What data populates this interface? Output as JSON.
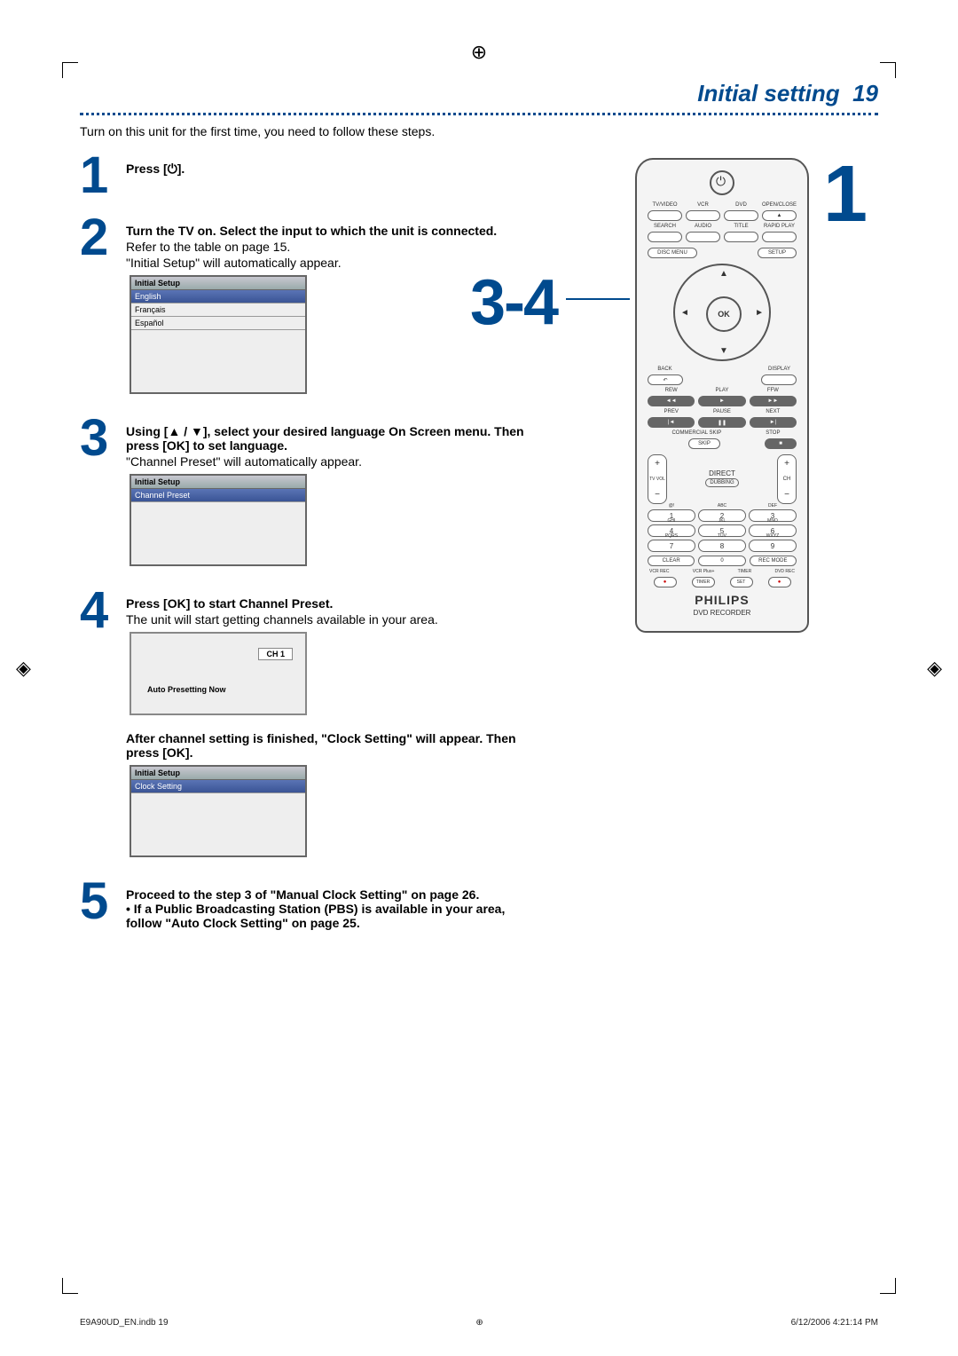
{
  "header": {
    "title": "Initial setting",
    "page": "19"
  },
  "intro": "Turn on this unit for the first time, you need to follow these steps.",
  "steps": {
    "s1": {
      "n": "1",
      "text": "Press [⏻]."
    },
    "s2": {
      "n": "2",
      "bold": "Turn the TV on. Select the input to which the unit is connected.",
      "line1": "Refer to the table on page 15.",
      "line2": "\"Initial Setup\" will automatically appear."
    },
    "s3": {
      "n": "3",
      "bold": "Using [▲ / ▼], select your desired language On Screen menu. Then press [OK] to set language.",
      "line1": "\"Channel Preset\" will automatically appear."
    },
    "s4": {
      "n": "4",
      "bold": "Press [OK] to start Channel Preset.",
      "line1": "The unit will start getting channels available in your area.",
      "after_bold": "After channel setting is finished, \"Clock Setting\" will appear. Then press [OK]."
    },
    "s5": {
      "n": "5",
      "bold": "Proceed to the step 3 of \"Manual Clock Setting\" on page 26.",
      "bullet": "• If a Public Broadcasting Station (PBS) is available in your area, follow \"Auto Clock Setting\" on page 25."
    }
  },
  "dialogs": {
    "lang": {
      "title": "Initial Setup",
      "opts": [
        "English",
        "Français",
        "Español"
      ]
    },
    "preset": {
      "title": "Initial Setup",
      "row": "Channel Preset"
    },
    "progress": {
      "ch": "CH 1",
      "msg": "Auto Presetting Now"
    },
    "clock": {
      "title": "Initial Setup",
      "row": "Clock Setting"
    }
  },
  "callouts": {
    "c1": "1",
    "c34": "3-4"
  },
  "remote": {
    "row1_labels": [
      "TV/VIDEO",
      "VCR",
      "DVD",
      "OPEN/CLOSE"
    ],
    "row2_labels": [
      "SEARCH",
      "AUDIO",
      "TITLE",
      "RAPID PLAY"
    ],
    "disc_menu": "DISC MENU",
    "setup": "SETUP",
    "ok": "OK",
    "back": "BACK",
    "display": "DISPLAY",
    "transport_labels_top": [
      "REW",
      "PLAY",
      "FFW"
    ],
    "transport_labels_bot": [
      "PREV",
      "PAUSE",
      "NEXT"
    ],
    "skip_row": [
      "COMMERCIAL SKIP",
      "STOP"
    ],
    "vol_lbl": "TV VOL",
    "ch_lbl": "CH",
    "direct": "DIRECT",
    "dubbing": "DUBBING",
    "num_labels": [
      "@!",
      "ABC",
      "DEF",
      "GHI",
      "JKL",
      "MNO",
      "PQRS",
      "TUV",
      "WXYZ"
    ],
    "nums": [
      "1",
      "2",
      "3",
      "4",
      "5",
      "6",
      "7",
      "8",
      "9"
    ],
    "bottom_row": [
      "CLEAR",
      "0",
      "REC MODE"
    ],
    "rec_labels": [
      "VCR REC",
      "VCR Plus+",
      "TIMER",
      "DVD REC"
    ],
    "rec_sub": [
      "",
      "TIMER",
      "SET",
      ""
    ],
    "brand": "PHILIPS",
    "brandsub": "DVD RECORDER"
  },
  "footer": {
    "left": "E9A90UD_EN.indb   19",
    "right": "6/12/2006   4:21:14 PM"
  }
}
